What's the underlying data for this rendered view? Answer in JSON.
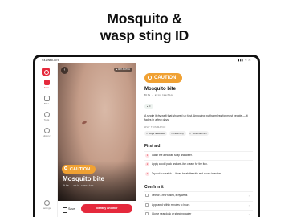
{
  "headline": [
    "Mosquito &",
    "wasp sting ID"
  ],
  "status": {
    "time": "9:41",
    "date": "Wed Jul 9",
    "indicators": "▮▮▮ ◠ ▭"
  },
  "sidebar": {
    "items": [
      {
        "label": "Scan",
        "active": true
      },
      {
        "label": "Bites"
      },
      {
        "label": "Tools"
      },
      {
        "label": "History"
      },
      {
        "label": "Settings"
      }
    ]
  },
  "photo": {
    "badge": "● 98% MATCH",
    "caution": "CAUTION",
    "name": "Mosquito bite",
    "sci": "Bite · skin reaction",
    "save_label": "Save",
    "identify_label": "Identify another"
  },
  "panel": {
    "caution": "CAUTION",
    "title": "Mosquito bite",
    "sci": "Bite · skin reaction",
    "chip": "● ID",
    "description": "A single itchy welt that showed up fast. Annoying but harmless for most people — it fades in a few days.",
    "why_label": "WHY THIS MATCH",
    "why_chips": [
      "Single raised welt",
      "Feels itchy",
      "Round and firm"
    ],
    "first_aid_title": "First aid",
    "first_aid": [
      "Wash the area with soap and water.",
      "Apply a cold pack and anti-itch cream for the itch.",
      "Try not to scratch — it can break the skin and cause infection."
    ],
    "confirm_title": "Confirm it",
    "confirm": [
      "One or a few raised, itchy welts",
      "Appeared within minutes to hours",
      "Worse near dusk or standing water"
    ]
  },
  "colors": {
    "accent": "#e5293c",
    "caution": "#f0a133"
  }
}
